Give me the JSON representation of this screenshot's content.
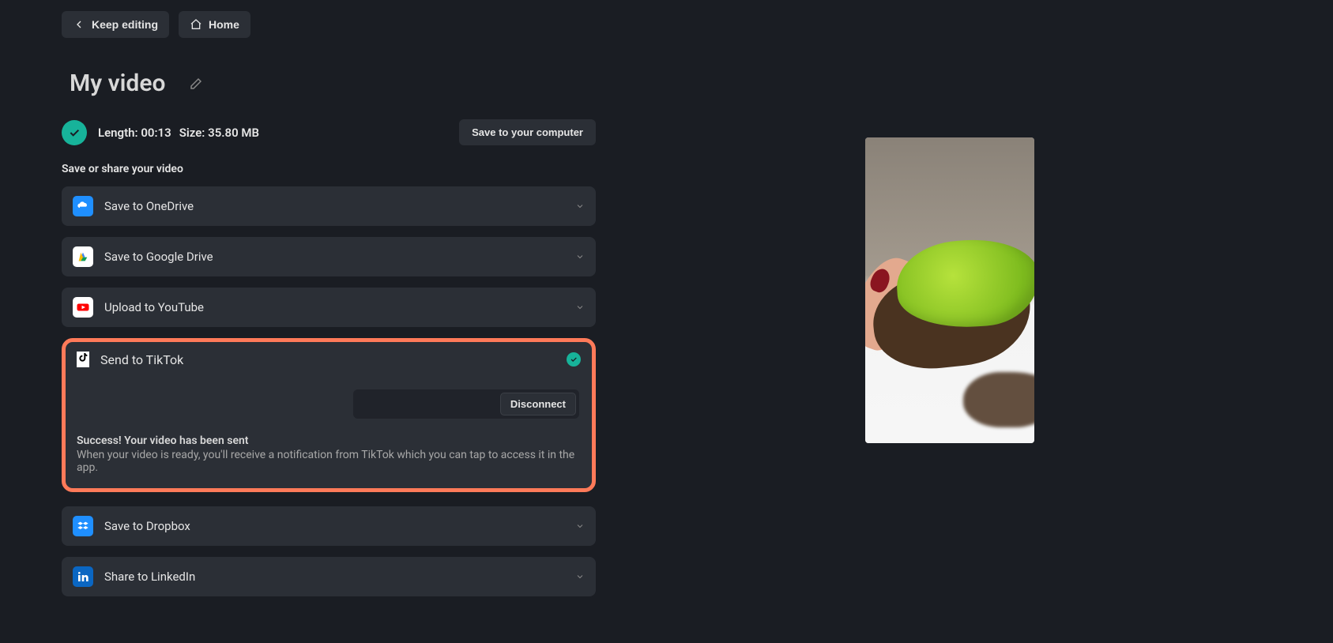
{
  "topbar": {
    "keep_editing": "Keep editing",
    "home": "Home"
  },
  "title": "My video",
  "meta": {
    "length_label": "Length:",
    "length_value": "00:13",
    "size_label": "Size:",
    "size_value": "35.80 MB",
    "save_to_computer": "Save to your computer"
  },
  "section_label": "Save or share your video",
  "destinations": {
    "onedrive": "Save to OneDrive",
    "gdrive": "Save to Google Drive",
    "youtube": "Upload to YouTube",
    "tiktok": "Send to TikTok",
    "dropbox": "Save to Dropbox",
    "linkedin": "Share to LinkedIn"
  },
  "tiktok_panel": {
    "disconnect": "Disconnect",
    "success_title": "Success! Your video has been sent",
    "success_body": "When your video is ready, you'll receive a notification from TikTok which you can tap to access it in the app."
  }
}
